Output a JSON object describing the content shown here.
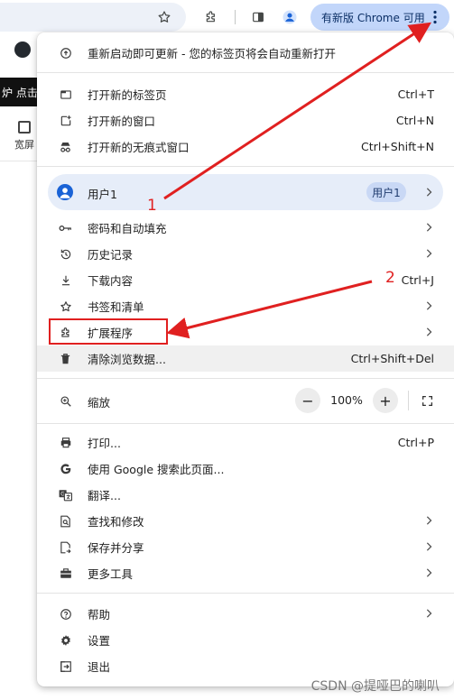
{
  "toolbar": {
    "update_label": "有新版 Chrome 可用"
  },
  "background": {
    "banner_text": "炉 点击",
    "tool_label": "宽屏"
  },
  "menu": {
    "relaunch": "重新启动即可更新 - 您的标签页将会自动重新打开",
    "new_tab": {
      "label": "打开新的标签页",
      "shortcut": "Ctrl+T"
    },
    "new_window": {
      "label": "打开新的窗口",
      "shortcut": "Ctrl+N"
    },
    "incognito": {
      "label": "打开新的无痕式窗口",
      "shortcut": "Ctrl+Shift+N"
    },
    "profile": {
      "label": "用户1",
      "badge": "用户1"
    },
    "passwords": "密码和自动填充",
    "history": "历史记录",
    "downloads": {
      "label": "下载内容",
      "shortcut": "Ctrl+J"
    },
    "bookmarks": "书签和清单",
    "extensions": "扩展程序",
    "clear_data": {
      "label": "清除浏览数据...",
      "shortcut": "Ctrl+Shift+Del"
    },
    "zoom": {
      "label": "缩放",
      "value": "100%",
      "minus": "−",
      "plus": "+"
    },
    "print": {
      "label": "打印...",
      "shortcut": "Ctrl+P"
    },
    "google_search": "使用 Google 搜索此页面...",
    "translate": "翻译...",
    "find_edit": "查找和修改",
    "save_share": "保存并分享",
    "more_tools": "更多工具",
    "help": "帮助",
    "settings": "设置",
    "exit": "退出"
  },
  "annotations": {
    "num1": "1",
    "num2": "2",
    "color": "#e02020"
  },
  "watermark": "CSDN @提哑巴的喇叭"
}
